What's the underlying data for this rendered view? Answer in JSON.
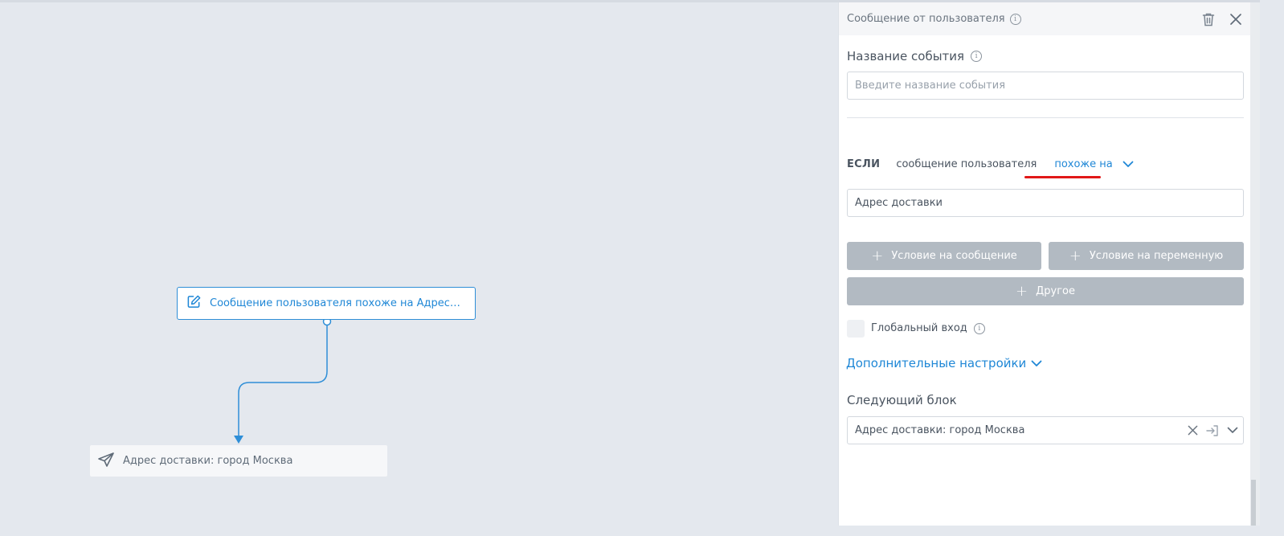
{
  "canvas": {
    "start_node": {
      "label": "Сообщение пользователя похоже на Адрес…",
      "icon": "edit-icon"
    },
    "end_node": {
      "label": "Адрес доставки: город Москва",
      "icon": "send-icon"
    }
  },
  "panel": {
    "title": "Сообщение от пользователя",
    "event_name": {
      "label": "Название события",
      "placeholder": "Введите название события",
      "value": ""
    },
    "condition": {
      "if_label": "ЕСЛИ",
      "subject": "сообщение пользователя",
      "operator": "похоже на",
      "value": "Адрес доставки"
    },
    "buttons": {
      "add_message_condition": "Условие на сообщение",
      "add_variable_condition": "Условие на переменную",
      "other": "Другое"
    },
    "global_entry": {
      "label": "Глобальный вход",
      "checked": false
    },
    "advanced_settings": "Дополнительные настройки",
    "next_block": {
      "label": "Следующий блок",
      "value": "Адрес доставки: город Москва"
    }
  },
  "colors": {
    "accent": "#1f87d6",
    "highlight_underline": "#e11818",
    "button_gray": "#b2bac2",
    "canvas_bg": "#e4e8ee"
  }
}
